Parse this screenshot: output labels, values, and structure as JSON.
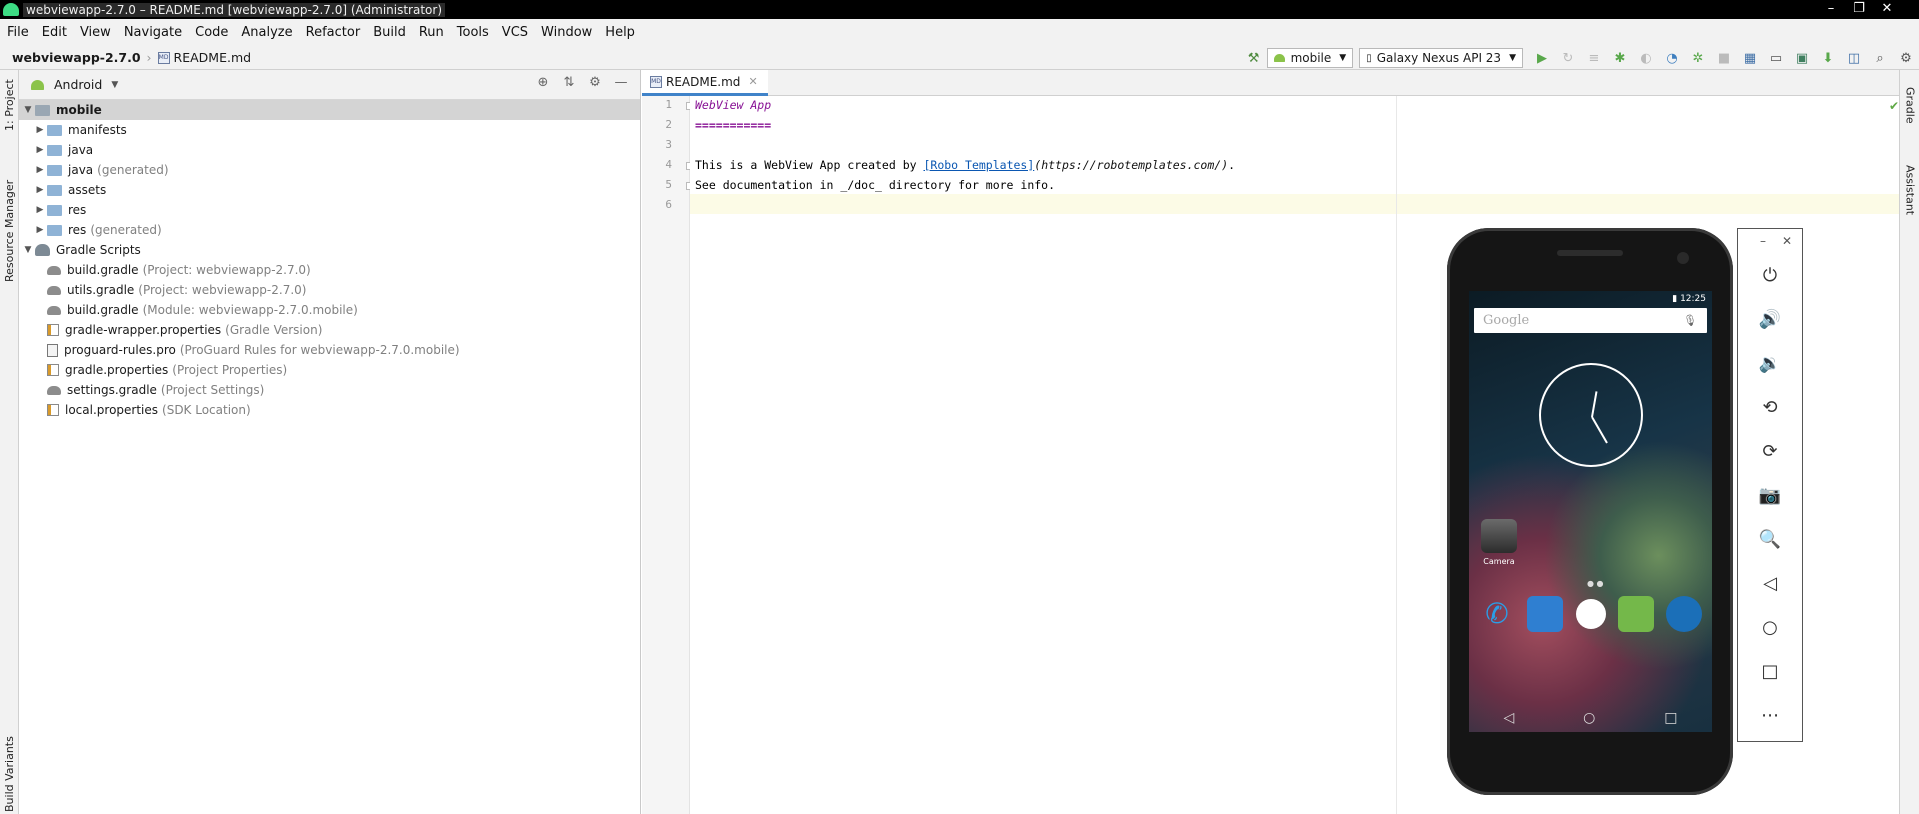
{
  "window": {
    "title": "webviewapp-2.7.0 – README.md [webviewapp-2.7.0] (Administrator)"
  },
  "menu": [
    "File",
    "Edit",
    "View",
    "Navigate",
    "Code",
    "Analyze",
    "Refactor",
    "Build",
    "Run",
    "Tools",
    "VCS",
    "Window",
    "Help"
  ],
  "breadcrumb": {
    "project": "webviewapp-2.7.0",
    "file": "README.md"
  },
  "toolbar": {
    "run_config": "mobile",
    "device": "Galaxy Nexus API 23"
  },
  "left_tool_tabs": {
    "project": "1: Project",
    "resource_manager": "Resource Manager",
    "build_variants": "Build Variants"
  },
  "right_tool_tabs": {
    "gradle": "Gradle",
    "assistant": "Assistant"
  },
  "project_panel": {
    "view_mode": "Android",
    "tree": [
      {
        "label": "mobile",
        "hint": "",
        "level": 0,
        "expanded": true,
        "kind": "module",
        "selected": true
      },
      {
        "label": "manifests",
        "hint": "",
        "level": 1,
        "expanded": false,
        "kind": "folder"
      },
      {
        "label": "java",
        "hint": "",
        "level": 1,
        "expanded": false,
        "kind": "folder"
      },
      {
        "label": "java",
        "hint": "(generated)",
        "level": 1,
        "expanded": false,
        "kind": "folder"
      },
      {
        "label": "assets",
        "hint": "",
        "level": 1,
        "expanded": false,
        "kind": "folder"
      },
      {
        "label": "res",
        "hint": "",
        "level": 1,
        "expanded": false,
        "kind": "folder"
      },
      {
        "label": "res",
        "hint": "(generated)",
        "level": 1,
        "expanded": false,
        "kind": "folder"
      },
      {
        "label": "Gradle Scripts",
        "hint": "",
        "level": 0,
        "expanded": true,
        "kind": "gradle-scripts"
      },
      {
        "label": "build.gradle",
        "hint": "(Project: webviewapp-2.7.0)",
        "level": 1,
        "kind": "gradle"
      },
      {
        "label": "utils.gradle",
        "hint": "(Project: webviewapp-2.7.0)",
        "level": 1,
        "kind": "gradle"
      },
      {
        "label": "build.gradle",
        "hint": "(Module: webviewapp-2.7.0.mobile)",
        "level": 1,
        "kind": "gradle"
      },
      {
        "label": "gradle-wrapper.properties",
        "hint": "(Gradle Version)",
        "level": 1,
        "kind": "properties"
      },
      {
        "label": "proguard-rules.pro",
        "hint": "(ProGuard Rules for webviewapp-2.7.0.mobile)",
        "level": 1,
        "kind": "pro"
      },
      {
        "label": "gradle.properties",
        "hint": "(Project Properties)",
        "level": 1,
        "kind": "properties"
      },
      {
        "label": "settings.gradle",
        "hint": "(Project Settings)",
        "level": 1,
        "kind": "gradle"
      },
      {
        "label": "local.properties",
        "hint": "(SDK Location)",
        "level": 1,
        "kind": "properties"
      }
    ]
  },
  "editor": {
    "tab": "README.md",
    "line_numbers": [
      "1",
      "2",
      "3",
      "4",
      "5",
      "6"
    ],
    "line1": "WebView App",
    "line2": "===========",
    "line4_prefix": "This is a WebView App created by ",
    "line4_link": "[Robo Templates]",
    "line4_url": "(https://robotemplates.com/)",
    "line4_suffix": ".",
    "line5": "See documentation in _/doc_ directory for more info."
  },
  "emulator": {
    "status_time": "12:25",
    "search_placeholder": "Google",
    "camera_label": "Camera",
    "controls": [
      "power-icon",
      "volume-up-icon",
      "volume-down-icon",
      "rotate-left-icon",
      "rotate-right-icon",
      "camera-icon",
      "zoom-icon",
      "back-icon",
      "home-icon",
      "overview-icon",
      "more-icon"
    ]
  }
}
